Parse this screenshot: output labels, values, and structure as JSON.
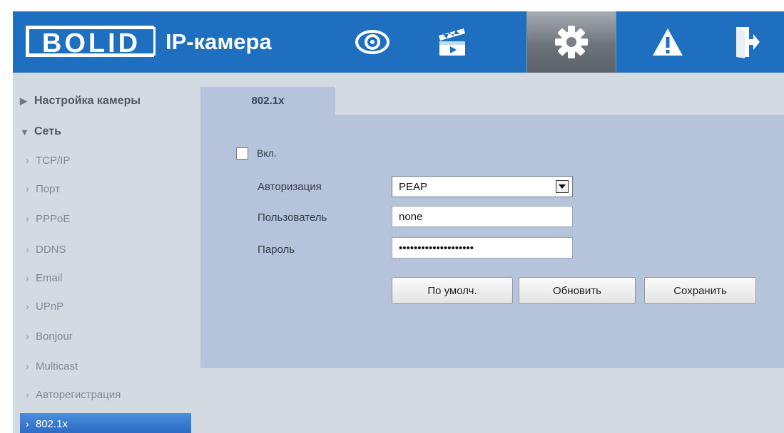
{
  "header": {
    "logo_text": "BOLID",
    "title": "IP-камера",
    "nav": [
      {
        "icon": "eye-icon"
      },
      {
        "icon": "clapperboard-icon"
      },
      {
        "icon": "gear-icon"
      },
      {
        "icon": "warning-icon"
      },
      {
        "icon": "logout-icon"
      }
    ],
    "accent_color": "#1f6fc0"
  },
  "sidebar": {
    "groups": [
      {
        "label": "Настройка камеры",
        "expanded": false
      },
      {
        "label": "Сеть",
        "expanded": true
      }
    ],
    "items": [
      {
        "label": "TCP/IP"
      },
      {
        "label": "Порт"
      },
      {
        "label": "PPPoE"
      },
      {
        "label": "DDNS"
      },
      {
        "label": "Email"
      },
      {
        "label": "UPnP"
      },
      {
        "label": "Bonjour"
      },
      {
        "label": "Multicast"
      },
      {
        "label": "Авторегистрация"
      },
      {
        "label": "802.1x",
        "active": true
      }
    ]
  },
  "main": {
    "tab_label": "802.1x",
    "enable_label": "Вкл.",
    "enable_checked": false,
    "fields": {
      "auth_label": "Авторизация",
      "auth_value": "PEAP",
      "user_label": "Пользователь",
      "user_value": "none",
      "password_label": "Пароль",
      "password_value": "••••••••••••••••••••"
    },
    "buttons": {
      "default": "По умолч.",
      "refresh": "Обновить",
      "save": "Сохранить"
    }
  }
}
